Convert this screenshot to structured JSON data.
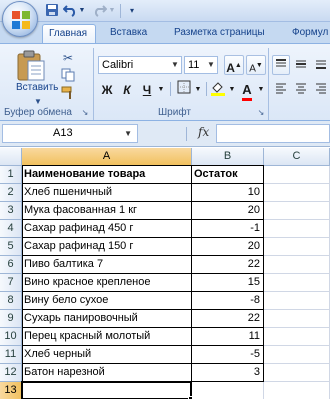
{
  "titlebar": {
    "qat_icons": [
      "save-icon",
      "undo-icon",
      "redo-icon",
      "customize-icon"
    ]
  },
  "tabs": [
    {
      "label": "Главная",
      "active": true
    },
    {
      "label": "Вставка",
      "active": false
    },
    {
      "label": "Разметка страницы",
      "active": false
    },
    {
      "label": "Формул",
      "active": false
    }
  ],
  "ribbon": {
    "clipboard": {
      "label": "Буфер обмена",
      "paste_label": "Вставить",
      "icons": [
        "paste-icon",
        "cut-icon",
        "copy-icon",
        "format-painter-icon"
      ]
    },
    "font": {
      "label": "Шрифт",
      "font_name": "Calibri",
      "font_size": "11",
      "grow_label": "A",
      "shrink_label": "A",
      "bold_label": "Ж",
      "italic_label": "К",
      "underline_label": "Ч",
      "font_color_label": "A",
      "fill_color": "#ffff00",
      "font_color": "#ff0000"
    }
  },
  "formula_bar": {
    "name_box": "A13",
    "fx_label": "fx",
    "formula": ""
  },
  "sheet": {
    "columns": [
      "A",
      "B",
      "C"
    ],
    "selected_column": "A",
    "selected_row": 13,
    "headers": {
      "name": "Наименование товара",
      "stock": "Остаток"
    },
    "rows": [
      {
        "row": 2,
        "name": "Хлеб пшеничный",
        "stock": "10"
      },
      {
        "row": 3,
        "name": "Мука фасованная 1 кг",
        "stock": "20"
      },
      {
        "row": 4,
        "name": "Сахар рафинад 450 г",
        "stock": "-1"
      },
      {
        "row": 5,
        "name": "Сахар рафинад 150 г",
        "stock": "20"
      },
      {
        "row": 6,
        "name": "Пиво балтика 7",
        "stock": "22"
      },
      {
        "row": 7,
        "name": "Вино красное крепленое",
        "stock": "15"
      },
      {
        "row": 8,
        "name": "Вину бело сухое",
        "stock": "-8"
      },
      {
        "row": 9,
        "name": "Сухарь панировочный",
        "stock": "22"
      },
      {
        "row": 10,
        "name": "Перец красный молотый",
        "stock": "11"
      },
      {
        "row": 11,
        "name": "Хлеб черный",
        "stock": "-5"
      },
      {
        "row": 12,
        "name": "Батон нарезной",
        "stock": "3"
      }
    ],
    "row_numbers": [
      "1",
      "2",
      "3",
      "4",
      "5",
      "6",
      "7",
      "8",
      "9",
      "10",
      "11",
      "12",
      "13"
    ]
  }
}
